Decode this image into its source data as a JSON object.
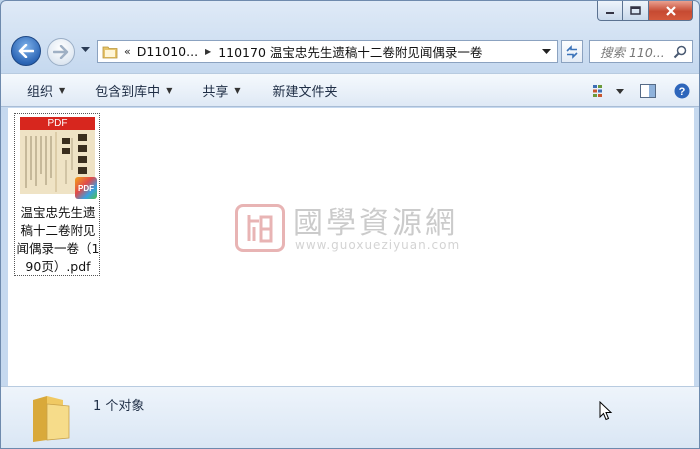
{
  "window": {
    "caption_buttons": [
      "minimize",
      "maximize",
      "close"
    ]
  },
  "address": {
    "segments": [
      "D11010...",
      "110170 温宝忠先生遗稿十二卷附见闻偶录一卷"
    ],
    "prefix": "«"
  },
  "search": {
    "placeholder": "搜索 110..."
  },
  "toolbar": {
    "organize": "组织",
    "include_library": "包含到库中",
    "share": "共享",
    "new_folder": "新建文件夹"
  },
  "file": {
    "name": "温宝忠先生遗稿十二卷附见闻偶录一卷（190页）.pdf",
    "thumb_label": "PDF",
    "badge": "PDF"
  },
  "watermark": {
    "title": "國學資源網",
    "url": "www.guoxueziyuan.com"
  },
  "status": {
    "count": "1 个对象"
  },
  "colors": {
    "accent": "#2c66b6",
    "pdf_red": "#d7261e",
    "close": "#c64a32"
  }
}
